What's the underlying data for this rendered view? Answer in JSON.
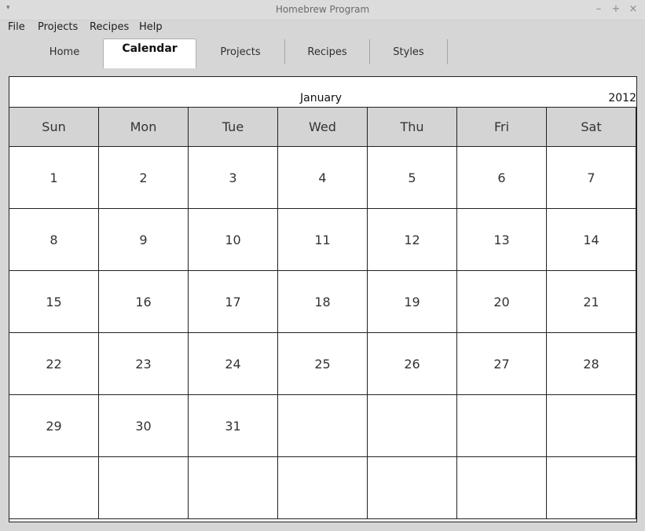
{
  "window": {
    "title": "Homebrew Program",
    "menu_glyph": "▾",
    "minimize": "–",
    "maximize": "+",
    "close": "×"
  },
  "menubar": [
    "File",
    "Projects",
    "Recipes",
    "Help"
  ],
  "tabs": [
    {
      "label": "Home",
      "active": false
    },
    {
      "label": "Calendar",
      "active": true
    },
    {
      "label": "Projects",
      "active": false
    },
    {
      "label": "Recipes",
      "active": false
    },
    {
      "label": "Styles",
      "active": false
    }
  ],
  "calendar": {
    "month": "January",
    "year": "2012",
    "weekdays": [
      "Sun",
      "Mon",
      "Tue",
      "Wed",
      "Thu",
      "Fri",
      "Sat"
    ],
    "weeks": [
      [
        "1",
        "2",
        "3",
        "4",
        "5",
        "6",
        "7"
      ],
      [
        "8",
        "9",
        "10",
        "11",
        "12",
        "13",
        "14"
      ],
      [
        "15",
        "16",
        "17",
        "18",
        "19",
        "20",
        "21"
      ],
      [
        "22",
        "23",
        "24",
        "25",
        "26",
        "27",
        "28"
      ],
      [
        "29",
        "30",
        "31",
        "",
        "",
        "",
        ""
      ],
      [
        "",
        "",
        "",
        "",
        "",
        "",
        ""
      ]
    ]
  }
}
